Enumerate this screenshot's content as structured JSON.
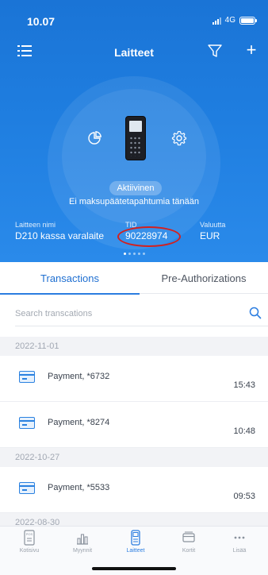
{
  "status_bar": {
    "time": "10.07",
    "network": "4G"
  },
  "header": {
    "title": "Laitteet"
  },
  "device": {
    "status": "Aktiivinen",
    "message": "Ei maksupäätetapahtumia tänään",
    "name_label": "Laitteen nimi",
    "name": "D210 kassa varalaite",
    "tid_label": "TID",
    "tid": "90228974",
    "currency_label": "Valuutta",
    "currency": "EUR",
    "page_dots": 5,
    "active_dot": 1
  },
  "tabs": [
    {
      "label": "Transactions",
      "active": true
    },
    {
      "label": "Pre-Authorizations",
      "active": false
    }
  ],
  "search": {
    "placeholder": "Search transcations",
    "value": ""
  },
  "transactions": [
    {
      "date": "2022-11-01",
      "items": [
        {
          "label": "Payment, *6732",
          "time": "15:43"
        },
        {
          "label": "Payment, *8274",
          "time": "10:48"
        }
      ]
    },
    {
      "date": "2022-10-27",
      "items": [
        {
          "label": "Payment, *5533",
          "time": "09:53"
        }
      ]
    },
    {
      "date": "2022-08-30",
      "items": []
    }
  ],
  "bottom_nav": [
    {
      "label": "Kotisivu",
      "icon": "pos-terminal-icon",
      "active": false
    },
    {
      "label": "Myynnit",
      "icon": "bar-chart-icon",
      "active": false
    },
    {
      "label": "Laitteet",
      "icon": "device-icon",
      "active": true
    },
    {
      "label": "Kortit",
      "icon": "cards-icon",
      "active": false
    },
    {
      "label": "Lisää",
      "icon": "more-icon",
      "active": false
    }
  ],
  "colors": {
    "primary": "#1f7ee0",
    "accent": "#2b7de0",
    "highlight_ring": "#d3201e"
  }
}
